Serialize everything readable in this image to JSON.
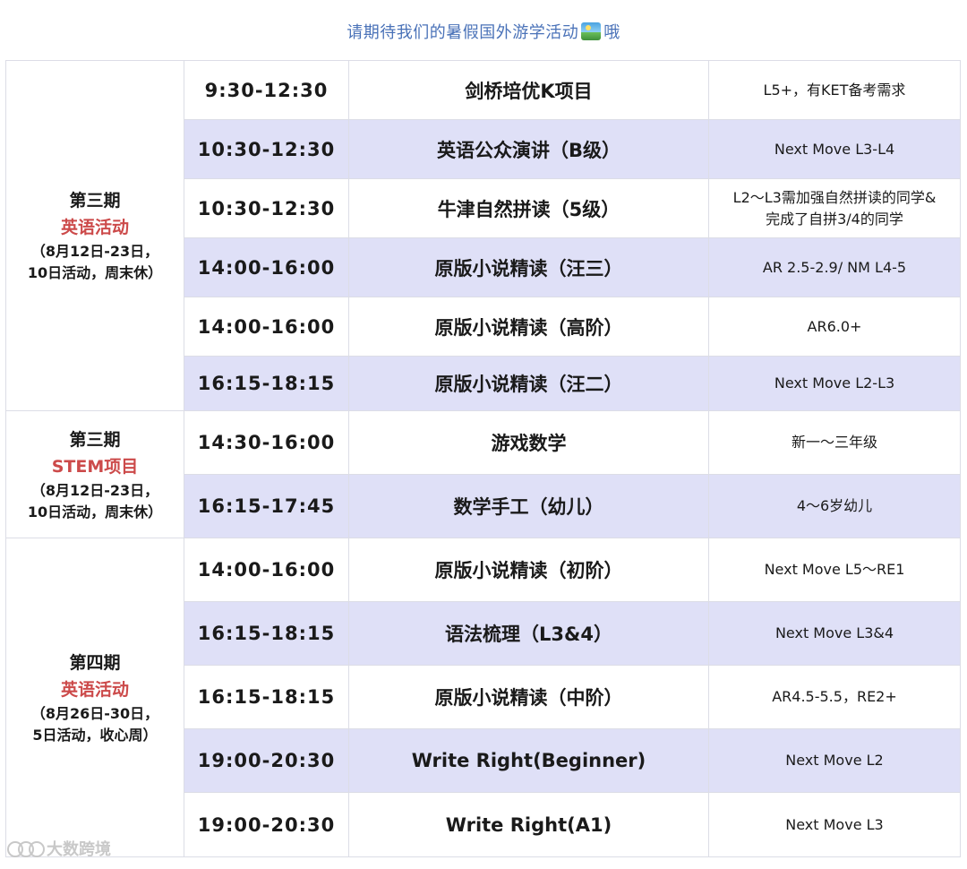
{
  "header": {
    "title": "请期待我们的暑假国外游学活动",
    "suffix": "哦",
    "icon": "scenery-icon"
  },
  "groups": [
    {
      "period": "第三期",
      "category": "英语活动",
      "dates": "（8月12日-23日，\n10日活动，周末休）",
      "rows": [
        {
          "time": "9:30-12:30",
          "course": "剑桥培优K项目",
          "target": "L5+，有KET备考需求"
        },
        {
          "time": "10:30-12:30",
          "course": "英语公众演讲（B级）",
          "target": "Next Move L3-L4"
        },
        {
          "time": "10:30-12:30",
          "course": "牛津自然拼读（5级）",
          "target": "L2～L3需加强自然拼读的同学&\n完成了自拼3/4的同学"
        },
        {
          "time": "14:00-16:00",
          "course": "原版小说精读（汪三）",
          "target": "AR 2.5-2.9/ NM L4-5"
        },
        {
          "time": "14:00-16:00",
          "course": "原版小说精读（高阶）",
          "target": "AR6.0+"
        },
        {
          "time": "16:15-18:15",
          "course": "原版小说精读（汪二）",
          "target": "Next Move L2-L3"
        }
      ]
    },
    {
      "period": "第三期",
      "category": "STEM项目",
      "dates": "（8月12日-23日，\n10日活动，周末休）",
      "rows": [
        {
          "time": "14:30-16:00",
          "course": "游戏数学",
          "target": "新一～三年级"
        },
        {
          "time": "16:15-17:45",
          "course": "数学手工（幼儿）",
          "target": "4～6岁幼儿"
        }
      ]
    },
    {
      "period": "第四期",
      "category": "英语活动",
      "dates": "（8月26日-30日，\n5日活动，收心周）",
      "rows": [
        {
          "time": "14:00-16:00",
          "course": "原版小说精读（初阶）",
          "target": "Next Move L5～RE1"
        },
        {
          "time": "16:15-18:15",
          "course": "语法梳理（L3&4）",
          "target": "Next Move L3&4"
        },
        {
          "time": "16:15-18:15",
          "course": "原版小说精读（中阶）",
          "target": "AR4.5-5.5，RE2+"
        },
        {
          "time": "19:00-20:30",
          "course": "Write Right(Beginner)",
          "target": "Next Move L2"
        },
        {
          "time": "19:00-20:30",
          "course": "Write Right(A1)",
          "target": "Next Move L3"
        }
      ]
    }
  ],
  "watermark": {
    "text": "大数跨境"
  },
  "colors": {
    "band": "#dfe0f7",
    "category_red": "#cc4a4a",
    "header_blue": "#4a72b8"
  }
}
